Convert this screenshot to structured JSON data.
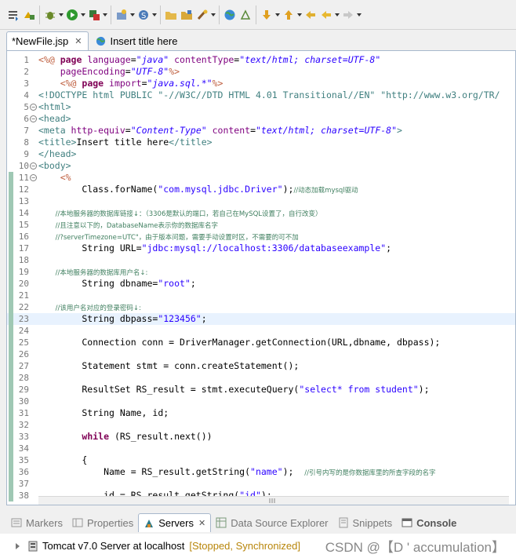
{
  "editor_tabs": [
    {
      "label": "*NewFile.jsp",
      "close": "✕"
    },
    {
      "label": "Insert title here"
    }
  ],
  "code_lines": [
    {
      "n": "1"
    },
    {
      "n": "2"
    },
    {
      "n": "3"
    },
    {
      "n": "4"
    },
    {
      "n": "5"
    },
    {
      "n": "6"
    },
    {
      "n": "7"
    },
    {
      "n": "8"
    },
    {
      "n": "9"
    },
    {
      "n": "10"
    },
    {
      "n": "11"
    },
    {
      "n": "12"
    },
    {
      "n": "13"
    },
    {
      "n": "14"
    },
    {
      "n": "15"
    },
    {
      "n": "16"
    },
    {
      "n": "17"
    },
    {
      "n": "18"
    },
    {
      "n": "19"
    },
    {
      "n": "20"
    },
    {
      "n": "21"
    },
    {
      "n": "22"
    },
    {
      "n": "23"
    },
    {
      "n": "24"
    },
    {
      "n": "25"
    },
    {
      "n": "26"
    },
    {
      "n": "27"
    },
    {
      "n": "28"
    },
    {
      "n": "29"
    },
    {
      "n": "30"
    },
    {
      "n": "31"
    },
    {
      "n": "32"
    },
    {
      "n": "33"
    },
    {
      "n": "34"
    },
    {
      "n": "35"
    },
    {
      "n": "36"
    },
    {
      "n": "37"
    },
    {
      "n": "38"
    }
  ],
  "code": {
    "l1a": "<%@ ",
    "l1b": "page ",
    "l1c": "language",
    "l1d": "=",
    "l1e": "\"java\"",
    "l1f": " contentType",
    "l1g": "=",
    "l1h": "\"text/html; charset=UTF-8\"",
    "l2a": "    pageEncoding",
    "l2b": "=",
    "l2c": "\"UTF-8\"",
    "l2d": "%>",
    "l3a": "    <%@ ",
    "l3b": "page ",
    "l3c": "import",
    "l3d": "=",
    "l3e": "\"java.sql.*\"",
    "l3f": "%>",
    "l4a": "<!DOCTYPE ",
    "l4b": "html ",
    "l4c": "PUBLIC ",
    "l4d": "\"-//W3C//DTD HTML 4.01 Transitional//EN\" \"http://www.w3.org/TR/",
    "l5": "<html>",
    "l6": "<head>",
    "l7a": "<meta ",
    "l7b": "http-equiv",
    "l7c": "=",
    "l7d": "\"Content-Type\"",
    "l7e": " content",
    "l7f": "=",
    "l7g": "\"text/html; charset=UTF-8\"",
    "l7h": ">",
    "l8a": "<title>",
    "l8b": "Insert title here",
    "l8c": "</title>",
    "l9": "</head>",
    "l10": "<body>",
    "l11": "    <%",
    "l12a": "        Class.forName(",
    "l12b": "\"com.mysql.jdbc.Driver\"",
    "l12c": ");",
    "l12d": "//动态加载mysql驱动",
    "l14": "        //本地服务器的数据库链接↓：（3306是默认的端口，若自己在MySQL设置了，自行改变）",
    "l15": "        //且注意以下的，DatabaseName表示你的数据库名字",
    "l16": "        //?serverTimezone=UTC\"，由于版本问题，需要手动设置时区，不需要的可不加",
    "l17a": "        String URL=",
    "l17b": "\"jdbc:mysql://localhost:3306/databaseexample\"",
    "l17c": ";",
    "l19": "        //本地服务器的数据库用户名↓:",
    "l20a": "        String dbname=",
    "l20b": "\"root\"",
    "l20c": ";",
    "l22": "        //该用户名对应的登录密码↓:",
    "l23a": "        String dbpass=",
    "l23b": "\"123456\"",
    "l23c": ";",
    "l25": "        Connection conn = DriverManager.getConnection(URL,dbname, dbpass);",
    "l27": "        Statement stmt = conn.createStatement();",
    "l29a": "        ResultSet RS_result = stmt.executeQuery(",
    "l29b": "\"select* from student\"",
    "l29c": ");",
    "l31": "        String Name, id;",
    "l33a": "        ",
    "l33b": "while",
    "l33c": " (RS_result.next())",
    "l35": "        {",
    "l36a": "            Name = RS_result.getString(",
    "l36b": "\"name\"",
    "l36c": ");  ",
    "l36d": "//引号内写的是你数据库里的所查字段的名字",
    "l38a": "            id = RS_result.getString(",
    "l38b": "\"id\"",
    "l38c": ");"
  },
  "bottom_tabs": [
    {
      "label": "Markers"
    },
    {
      "label": "Properties"
    },
    {
      "label": "Servers",
      "close": "✕"
    },
    {
      "label": "Data Source Explorer"
    },
    {
      "label": "Snippets"
    },
    {
      "label": "Console"
    }
  ],
  "server": {
    "name": "Tomcat v7.0 Server at localhost",
    "status": "[Stopped, Synchronized]"
  },
  "watermark": "CSDN @【D ' accumulation】",
  "colors": {
    "keyword": "#7f0055",
    "string": "#2a00ff",
    "comment": "#3f7f5f",
    "tag": "#3f7f7f",
    "attribute": "#7f007f",
    "jsp_delim": "#bf5f3f"
  }
}
